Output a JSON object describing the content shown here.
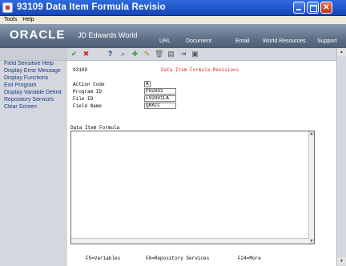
{
  "window": {
    "title": "93109    Data Item Formula Revisio"
  },
  "menubar": {
    "items": [
      "Tools",
      "Help"
    ]
  },
  "banner": {
    "logo": "ORACLE",
    "product": "JD Edwards World",
    "nav": [
      "URL",
      "Document",
      "Email",
      "World Resources",
      "Support"
    ]
  },
  "toolbar": {
    "icons": [
      "ok-icon",
      "cancel-icon",
      "help-icon",
      "inquire-icon",
      "add-icon",
      "change-icon",
      "delete-icon",
      "copy-icon",
      "link-icon",
      "display-icon"
    ],
    "glyphs": [
      "✔",
      "✖",
      "?",
      "⌕",
      "✚",
      "✎",
      "🗑",
      "▤",
      "⇥",
      "▣"
    ]
  },
  "sidebar": {
    "items": [
      "Field Sensitive Help",
      "Display Error Message",
      "Display Functions",
      "Exit Program",
      "Display Variable Definit",
      "Repository Services",
      "Clear Screen"
    ]
  },
  "form": {
    "id": "93109",
    "title": "Data Item Formula Revisions",
    "fields": [
      {
        "label": "Action Code",
        "value": "A"
      },
      {
        "label": "Program ID",
        "value": "P92801"
      },
      {
        "label": "File ID",
        "value": "F92801LA"
      },
      {
        "label": "Field Name",
        "value": "QKKCC"
      }
    ],
    "formula_label": "Data Item Formula",
    "formula_value": ""
  },
  "function_keys": [
    "F5=Variables",
    "F6=Repository Services",
    "F24=More"
  ],
  "colors": {
    "title_bar": "#1d52c8",
    "form_title": "#c8321e",
    "sidebar_link": "#1a3b8a"
  }
}
